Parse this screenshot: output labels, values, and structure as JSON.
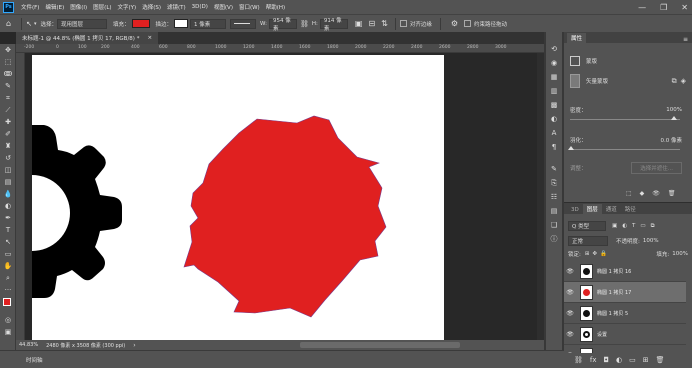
{
  "menu": [
    "文件(F)",
    "编辑(E)",
    "图像(I)",
    "图层(L)",
    "文字(Y)",
    "选择(S)",
    "滤镜(T)",
    "3D(D)",
    "视图(V)",
    "窗口(W)",
    "帮助(H)"
  ],
  "options": {
    "mode": "形状",
    "pick_label": "选择：",
    "pick_value": "现用图层",
    "fill_label": "填充：",
    "stroke_label": "描边：",
    "stroke_width": "1 像素",
    "w_label": "W:",
    "w_value": "954 像素",
    "link_icon": "link-icon",
    "h_label": "H:",
    "h_value": "914 像素",
    "align_edges": "对齐边缘",
    "constrain_path": "约束路径拖动",
    "fill_color": "#e02020"
  },
  "doc_tab": {
    "title": "未标题-1 @ 44.8% (椭圆 1 拷贝 17, RGB/8) *",
    "close": "×"
  },
  "ruler": [
    "-200",
    "0",
    "100",
    "200",
    "400",
    "600",
    "800",
    "1000",
    "1200",
    "1400",
    "1600",
    "1800",
    "2000",
    "2200",
    "2400",
    "2600",
    "2800",
    "3000"
  ],
  "status": {
    "zoom": "44.83%",
    "doc_info": "2480 像素 x 3508 像素 (300 ppi)"
  },
  "timeline": {
    "label": "时间轴"
  },
  "properties": {
    "tab": "属性",
    "section": "蒙版",
    "mask_type": "矢量蒙版",
    "density_label": "密度：",
    "density_value": "100%",
    "feather_label": "羽化：",
    "feather_value": "0.0 像素",
    "refine_label": "调整：",
    "select_refine": "选择并遮住..."
  },
  "layers": {
    "tabs": [
      "3D",
      "图层",
      "通道",
      "路径"
    ],
    "kind_filter": "Q 类型",
    "blend_mode": "正常",
    "opacity_label": "不透明度:",
    "opacity_value": "100%",
    "lock_label": "锁定:",
    "fill_label": "填充:",
    "fill_value": "100%",
    "items": [
      {
        "name": "椭圆 1 拷贝 16",
        "selected": false
      },
      {
        "name": "椭圆 1 拷贝 17",
        "selected": true
      },
      {
        "name": "椭圆 1 拷贝 5",
        "selected": false
      },
      {
        "name": "设置",
        "selected": false
      },
      {
        "name": "",
        "selected": false
      }
    ]
  }
}
